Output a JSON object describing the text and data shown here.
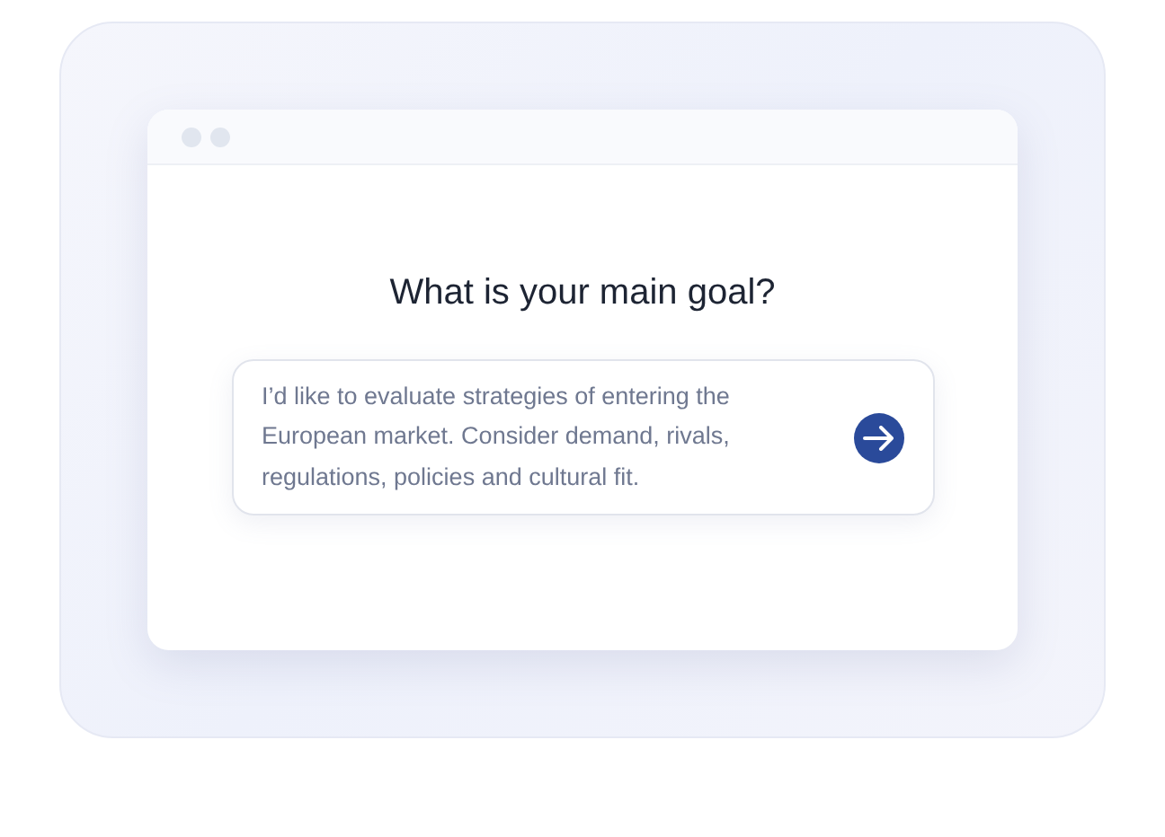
{
  "question": {
    "title": "What is your main goal?"
  },
  "answer": {
    "value": "I’d like to evaluate strategies of entering the European market. Consider demand, rivals, regulations, policies and cultural fit."
  }
}
